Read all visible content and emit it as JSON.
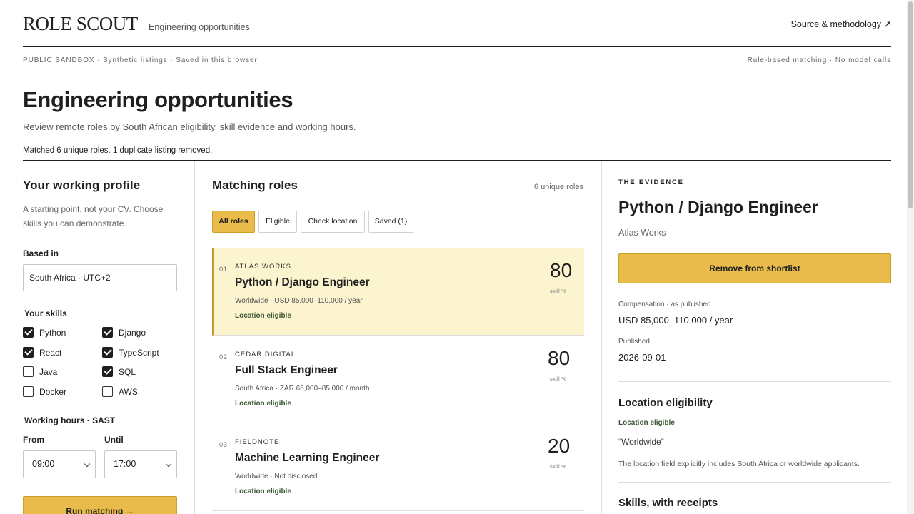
{
  "header": {
    "logo": "ROLE SCOUT",
    "subtitle": "Engineering opportunities",
    "source_link": "Source & methodology ↗"
  },
  "meta": {
    "left": "PUBLIC SANDBOX · Synthetic listings · Saved in this browser",
    "right": "Rule-based matching · No model calls"
  },
  "page": {
    "title": "Engineering opportunities",
    "description": "Review remote roles by South African eligibility, skill evidence and working hours.",
    "match_status": "Matched 6 unique roles. 1 duplicate listing removed."
  },
  "profile": {
    "title": "Your working profile",
    "description": "A starting point, not your CV. Choose skills you can demonstrate.",
    "based_in_label": "Based in",
    "based_in_value": "South Africa · UTC+2",
    "skills_label": "Your skills",
    "skills": [
      {
        "name": "Python",
        "checked": true
      },
      {
        "name": "Django",
        "checked": true
      },
      {
        "name": "React",
        "checked": true
      },
      {
        "name": "TypeScript",
        "checked": true
      },
      {
        "name": "Java",
        "checked": false
      },
      {
        "name": "SQL",
        "checked": true
      },
      {
        "name": "Docker",
        "checked": false
      },
      {
        "name": "AWS",
        "checked": false
      }
    ],
    "hours_label": "Working hours · SAST",
    "from_label": "From",
    "from_value": "09:00",
    "until_label": "Until",
    "until_value": "17:00",
    "run_button": "Run matching →"
  },
  "roles": {
    "title": "Matching roles",
    "count": "6 unique roles",
    "filters": [
      "All roles",
      "Eligible",
      "Check location",
      "Saved (1)"
    ],
    "active_filter": 0,
    "score_label": "skill %",
    "items": [
      {
        "num": "01",
        "company": "ATLAS WORKS",
        "title": "Python / Django Engineer",
        "details": "Worldwide · USD 85,000–110,000 / year",
        "status": "Location eligible",
        "score": "80",
        "selected": true
      },
      {
        "num": "02",
        "company": "CEDAR DIGITAL",
        "title": "Full Stack Engineer",
        "details": "South Africa · ZAR 65,000–85,000 / month",
        "status": "Location eligible",
        "score": "80",
        "selected": false
      },
      {
        "num": "03",
        "company": "FIELDNOTE",
        "title": "Machine Learning Engineer",
        "details": "Worldwide · Not disclosed",
        "status": "Location eligible",
        "score": "20",
        "selected": false
      }
    ]
  },
  "evidence": {
    "eyebrow": "THE EVIDENCE",
    "title": "Python / Django Engineer",
    "company": "Atlas Works",
    "shortlist_button": "Remove from shortlist",
    "compensation_label": "Compensation · as published",
    "compensation_value": "USD 85,000–110,000 / year",
    "published_label": "Published",
    "published_value": "2026-09-01",
    "location_title": "Location eligibility",
    "location_status": "Location eligible",
    "location_quote": "“Worldwide”",
    "location_explain": "The location field explicitly includes South Africa or worldwide applicants.",
    "skills_title": "Skills, with receipts"
  },
  "colors": {
    "accent": "#e9bb4a",
    "selected_bg": "#fcf3cf",
    "eligible_text": "#3d5a36"
  }
}
